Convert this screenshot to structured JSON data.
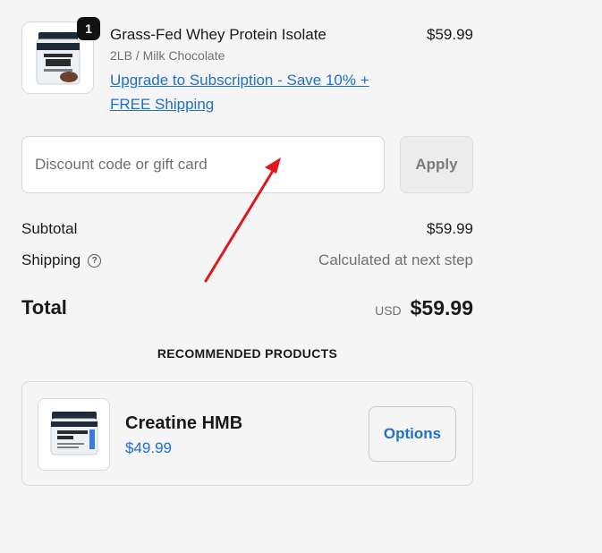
{
  "line_item": {
    "quantity": "1",
    "title": "Grass-Fed Whey Protein Isolate",
    "variant": "2LB / Milk Chocolate",
    "upgrade_link": "Upgrade to Subscription - Save 10% + FREE Shipping",
    "price": "$59.99",
    "image_icon": "protein-tub-image"
  },
  "discount": {
    "placeholder": "Discount code or gift card",
    "apply_label": "Apply"
  },
  "summary": {
    "subtotal_label": "Subtotal",
    "subtotal_value": "$59.99",
    "shipping_label": "Shipping",
    "shipping_help_icon": "question-circle-icon",
    "shipping_value": "Calculated at next step",
    "total_label": "Total",
    "currency": "USD",
    "total_value": "$59.99"
  },
  "recommended": {
    "heading": "RECOMMENDED PRODUCTS",
    "products": [
      {
        "name": "Creatine HMB",
        "price": "$49.99",
        "options_label": "Options",
        "image_icon": "creatine-tub-image"
      }
    ]
  },
  "annotation": {
    "arrow_color": "#e3161b"
  },
  "colors": {
    "link": "#1f6fcc",
    "background": "#f5f5f5"
  }
}
